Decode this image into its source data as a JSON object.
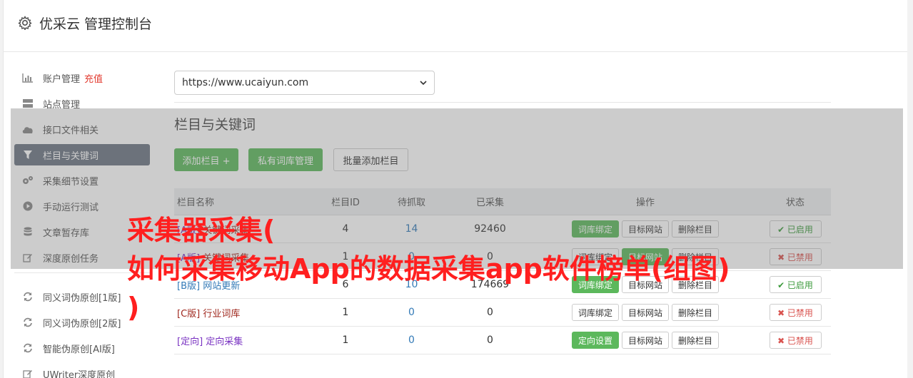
{
  "header": {
    "title": "优采云 管理控制台"
  },
  "sidebar": {
    "items": [
      {
        "label": "账户管理",
        "accent": "充值",
        "icon": "bar-chart-icon"
      },
      {
        "label": "站点管理",
        "icon": "server-icon"
      },
      {
        "label": "接口文件相关",
        "icon": "cloud-upload-icon"
      },
      {
        "label": "栏目与关键词",
        "icon": "filter-icon",
        "active": true
      },
      {
        "label": "采集细节设置",
        "icon": "gears-icon"
      },
      {
        "label": "手动运行测试",
        "icon": "play-icon"
      },
      {
        "label": "文章暂存库",
        "icon": "database-icon"
      },
      {
        "label": "深度原创任务",
        "icon": "edit-icon"
      }
    ],
    "items2": [
      {
        "label": "同义词伪原创[1版]",
        "icon": "refresh-icon"
      },
      {
        "label": "同义词伪原创[2版]",
        "icon": "refresh-icon"
      },
      {
        "label": "智能伪原创[AI版]",
        "icon": "refresh-icon"
      },
      {
        "label": "UWriter深度原创",
        "icon": "edit-icon"
      }
    ]
  },
  "site_select": {
    "value": "https://www.ucaiyun.com"
  },
  "section": {
    "title": "栏目与关键词"
  },
  "buttons": {
    "add": "添加栏目 +",
    "private": "私有词库管理",
    "batch": "批量添加栏目"
  },
  "table": {
    "headers": {
      "name": "栏目名称",
      "id": "栏目ID",
      "wait": "待抓取",
      "done": "已采集",
      "ops": "操作",
      "status": "状态"
    },
    "rows": [
      {
        "tag": "[A版]",
        "name": "关键词采集",
        "id": "4",
        "wait": "14",
        "done": "92460",
        "op1": "词库绑定",
        "op2": "目标网站",
        "op3": "删除栏目",
        "status": "✔ 已启用",
        "on": true
      },
      {
        "tag": "[A版]",
        "name": "关键词采集",
        "id": "1",
        "wait": "0",
        "done": "0",
        "op1": "词库绑定",
        "op2": "目标网站",
        "op3": "删除栏目",
        "status": "✖ 已禁用",
        "on": false
      },
      {
        "tag": "[B版]",
        "name": "网站更新",
        "id": "6",
        "wait": "10",
        "done": "174669",
        "op1": "词库绑定",
        "op2": "目标网站",
        "op3": "删除栏目",
        "status": "✔ 已启用",
        "on": true
      },
      {
        "tag": "[C版]",
        "name": "行业词库",
        "id": "1",
        "wait": "0",
        "done": "0",
        "op1": "词库绑定",
        "op2": "目标网站",
        "op3": "删除栏目",
        "status": "✖ 已禁用",
        "on": false
      },
      {
        "tag": "[定向]",
        "name": "定向采集",
        "id": "1",
        "wait": "0",
        "done": "0",
        "op1": "定向设置",
        "op2": "目标网站",
        "op3": "删除栏目",
        "status": "✖ 已禁用",
        "on": false
      }
    ]
  },
  "overlay": {
    "line1": "采集器采集(",
    "line2": "如何采集移动App的数据采集app软件榜单(组图)",
    "line3": ")"
  }
}
